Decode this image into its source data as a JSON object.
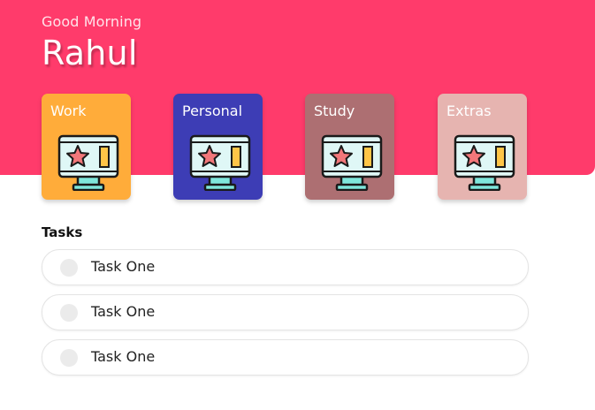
{
  "header": {
    "greeting": "Good Morning",
    "name": "Rahul",
    "color": "#ff3b6b"
  },
  "categories": [
    {
      "label": "Work",
      "color": "#ffac3a",
      "icon": "monitor-star-icon"
    },
    {
      "label": "Personal",
      "color": "#3d3db5",
      "icon": "monitor-star-icon"
    },
    {
      "label": "Study",
      "color": "#ad6f72",
      "icon": "monitor-star-icon"
    },
    {
      "label": "Extras",
      "color": "#e6b4b0",
      "icon": "monitor-star-icon"
    }
  ],
  "tasks": {
    "title": "Tasks",
    "items": [
      {
        "label": "Task One"
      },
      {
        "label": "Task One"
      },
      {
        "label": "Task One"
      }
    ]
  }
}
